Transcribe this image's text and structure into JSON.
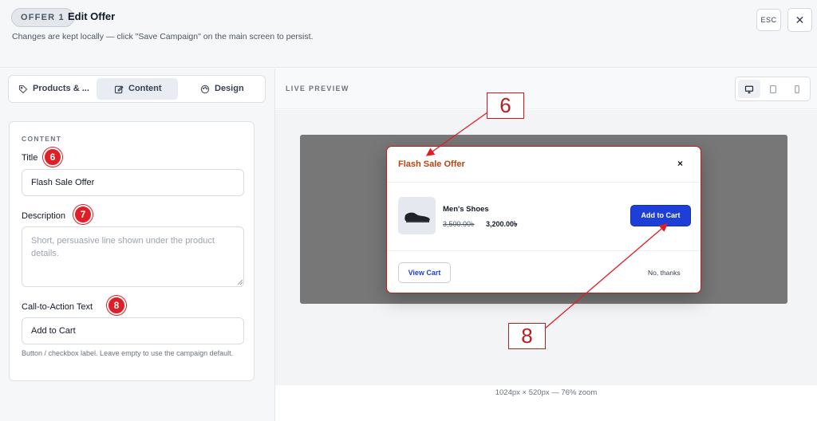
{
  "header": {
    "badge": "OFFER 1",
    "title": "Edit Offer",
    "subtitle": "Changes are kept locally — click \"Save Campaign\" on the main screen to persist.",
    "esc_label": "ESC",
    "close_glyph": "✕"
  },
  "tabs": [
    {
      "label": "Products & ...",
      "icon": "tag-icon",
      "active": false
    },
    {
      "label": "Content",
      "icon": "edit-icon",
      "active": true
    },
    {
      "label": "Design",
      "icon": "palette-icon",
      "active": false
    }
  ],
  "content": {
    "section_label": "CONTENT",
    "title_label": "Title",
    "title_value": "Flash Sale Offer",
    "description_label": "Description",
    "description_placeholder": "Short, persuasive line shown under the product details.",
    "cta_label": "Call-to-Action Text",
    "cta_value": "Add to Cart",
    "cta_hint": "Button / checkbox label. Leave empty to use the campaign default."
  },
  "markers": {
    "title": "6",
    "description": "7",
    "cta": "8"
  },
  "preview": {
    "label": "LIVE PREVIEW",
    "devices": [
      "desktop-icon",
      "tablet-icon",
      "mobile-icon"
    ],
    "modal_title": "Flash Sale Offer",
    "close_glyph": "×",
    "product_name": "Men's Shoes",
    "old_price": "3,500.00৳",
    "new_price": "3,200.00৳",
    "add_to_cart": "Add to Cart",
    "view_cart": "View Cart",
    "no_thanks": "No, thanks",
    "footer": "1024px × 520px — 76% zoom"
  },
  "callouts": {
    "top": "6",
    "bottom": "8"
  },
  "colors": {
    "accent": "#1d3fd8",
    "annotation_red": "#e11d25",
    "modal_title": "#c2410c"
  }
}
